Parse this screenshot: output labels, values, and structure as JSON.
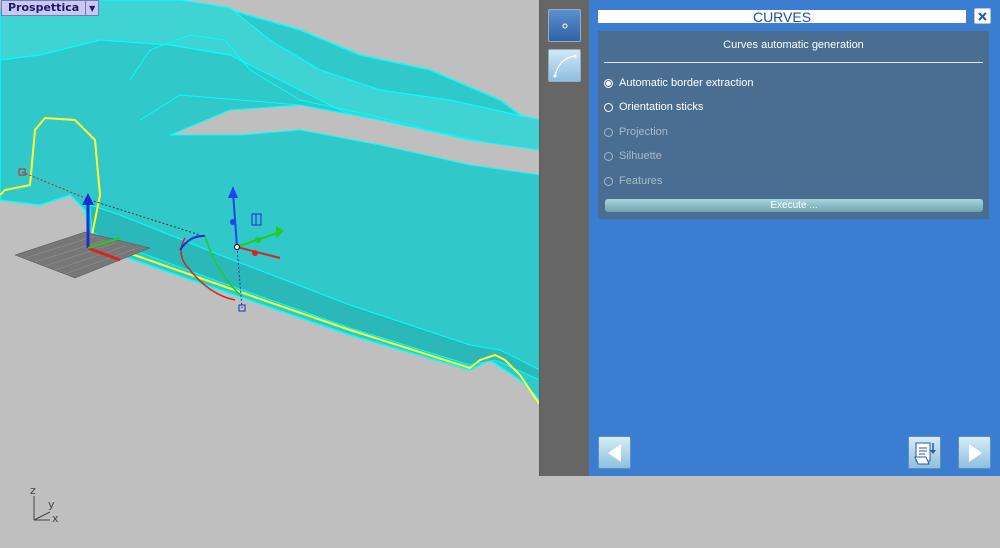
{
  "viewport": {
    "label": "Prospettica",
    "axes": {
      "z": "z",
      "y": "y",
      "x": "x"
    }
  },
  "panel": {
    "title": "CURVES",
    "subtitle": "Curves automatic generation",
    "options": [
      {
        "label": "Automatic border extraction",
        "checked": true,
        "enabled": true
      },
      {
        "label": "Orientation sticks",
        "checked": false,
        "enabled": true
      },
      {
        "label": "Projection",
        "checked": false,
        "enabled": false
      },
      {
        "label": "Silhuette",
        "checked": false,
        "enabled": false
      },
      {
        "label": "Features",
        "checked": false,
        "enabled": false
      }
    ],
    "execute_label": "Execute ...",
    "icons": {
      "close": "close-icon",
      "prev": "arrow-left-icon",
      "next": "arrow-right-icon",
      "save": "save-document-icon",
      "sidebar_point": "point-icon",
      "sidebar_curve": "curve-icon"
    },
    "colors": {
      "panel_bg": "#3b7dd1",
      "inner_bg": "#4a6e91",
      "sidebar_bg": "#666666",
      "model": "#33c9c9",
      "model_edge": "#00ffff",
      "border_curve": "#ffff33"
    }
  }
}
